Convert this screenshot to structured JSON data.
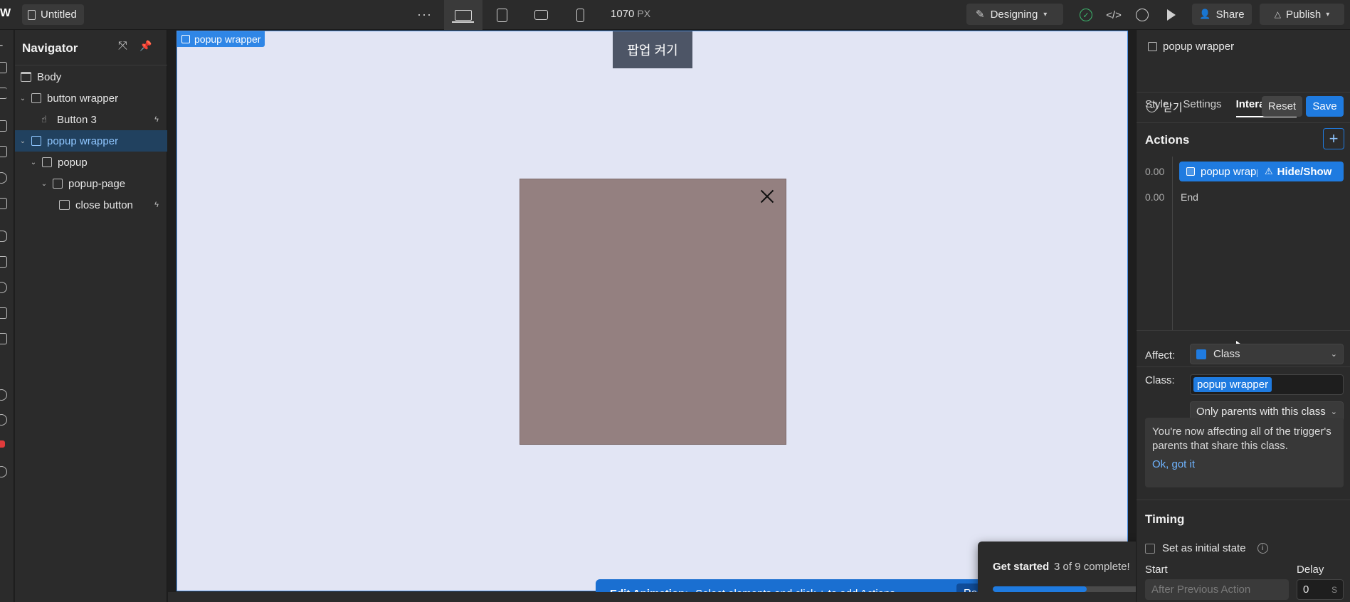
{
  "topbar": {
    "file_name": "Untitled",
    "more_label": "···",
    "width_value": "1070",
    "width_unit": "PX",
    "mode_label": "Designing",
    "share_label": "Share",
    "publish_label": "Publish"
  },
  "navigator": {
    "title": "Navigator",
    "items": [
      {
        "label": "Body"
      },
      {
        "label": "button wrapper"
      },
      {
        "label": "Button 3"
      },
      {
        "label": "popup wrapper"
      },
      {
        "label": "popup"
      },
      {
        "label": "popup-page"
      },
      {
        "label": "close button"
      }
    ]
  },
  "canvas": {
    "selection_tag": "popup wrapper",
    "open_button_label": "팝업 켜기"
  },
  "edit_animation": {
    "title": "Edit Animation:",
    "hint": "Select elements and click + to add Actions",
    "reset_label": "Reset"
  },
  "get_started": {
    "title": "Get started",
    "progress_text": "3 of 9 complete!",
    "progress_fraction": 0.333
  },
  "right_panel": {
    "element_name": "popup wrapper",
    "tabs": [
      {
        "label": "Style"
      },
      {
        "label": "Settings"
      },
      {
        "label": "Interactions"
      }
    ],
    "trigger_name": "닫기",
    "reset_label": "Reset",
    "save_label": "Save",
    "actions_title": "Actions",
    "timeline": [
      {
        "time": "0.00",
        "target": "popup wrapper",
        "type": "Hide/Show"
      },
      {
        "time": "0.00",
        "label": "End"
      }
    ],
    "affect_label": "Affect:",
    "affect_value": "Class",
    "class_label": "Class:",
    "class_value": "popup wrapper",
    "scope_value": "Only parents with this class",
    "info_text": "You're now affecting all of the trigger's parents that share this class.",
    "info_link": "Ok, got it",
    "timing_title": "Timing",
    "initial_state_label": "Set as initial state",
    "start_label": "Start",
    "start_value": "After Previous Action",
    "delay_label": "Delay",
    "delay_value": "0",
    "delay_unit": "S"
  },
  "colors": {
    "accent": "#1f7be0",
    "canvas_bg": "#e2e5f4",
    "popup_bg": "#948080",
    "selected_row": "#21415f"
  }
}
